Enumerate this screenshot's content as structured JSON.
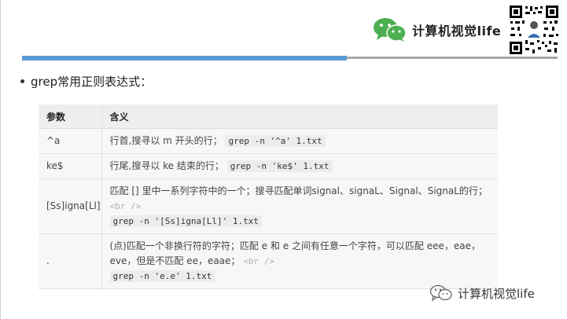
{
  "brand": {
    "top_text": "计算机视觉life",
    "bottom_text": "计算机视觉life"
  },
  "heading": "grep常用正则表达式：",
  "table": {
    "headers": [
      "参数",
      "含义"
    ],
    "rows": [
      {
        "param": "^a",
        "desc": "行首,搜寻以 m 开头的行；",
        "code": "grep -n '^a' 1.txt"
      },
      {
        "param": "ke$",
        "desc": "行尾,搜寻以 ke 结束的行；",
        "code": "grep -n 'ke$' 1.txt"
      },
      {
        "param": "[Ss]igna[Ll]",
        "desc": "匹配 [] 里中一系列字符中的一个；搜寻匹配单词signal、signaL、Signal、SignaL的行；",
        "br": "<br />",
        "code": "grep -n '[Ss]igna[Ll]' 1.txt"
      },
      {
        "param": ".",
        "desc": "(点)匹配一个非换行符的字符；匹配 e 和 e 之间有任意一个字符，可以匹配 eee，eae，eve，但是不匹配 ee，eaae；",
        "br": "<br />",
        "code": "grep -n 'e.e' 1.txt"
      }
    ]
  },
  "colors": {
    "accent_bar": "#5b9bd5",
    "wechat_green": "#4caf50",
    "divider_grey": "#a6a6a6"
  },
  "icons": [
    "wechat-logo-icon",
    "qr-code-icon",
    "wechat-outline-icon"
  ]
}
